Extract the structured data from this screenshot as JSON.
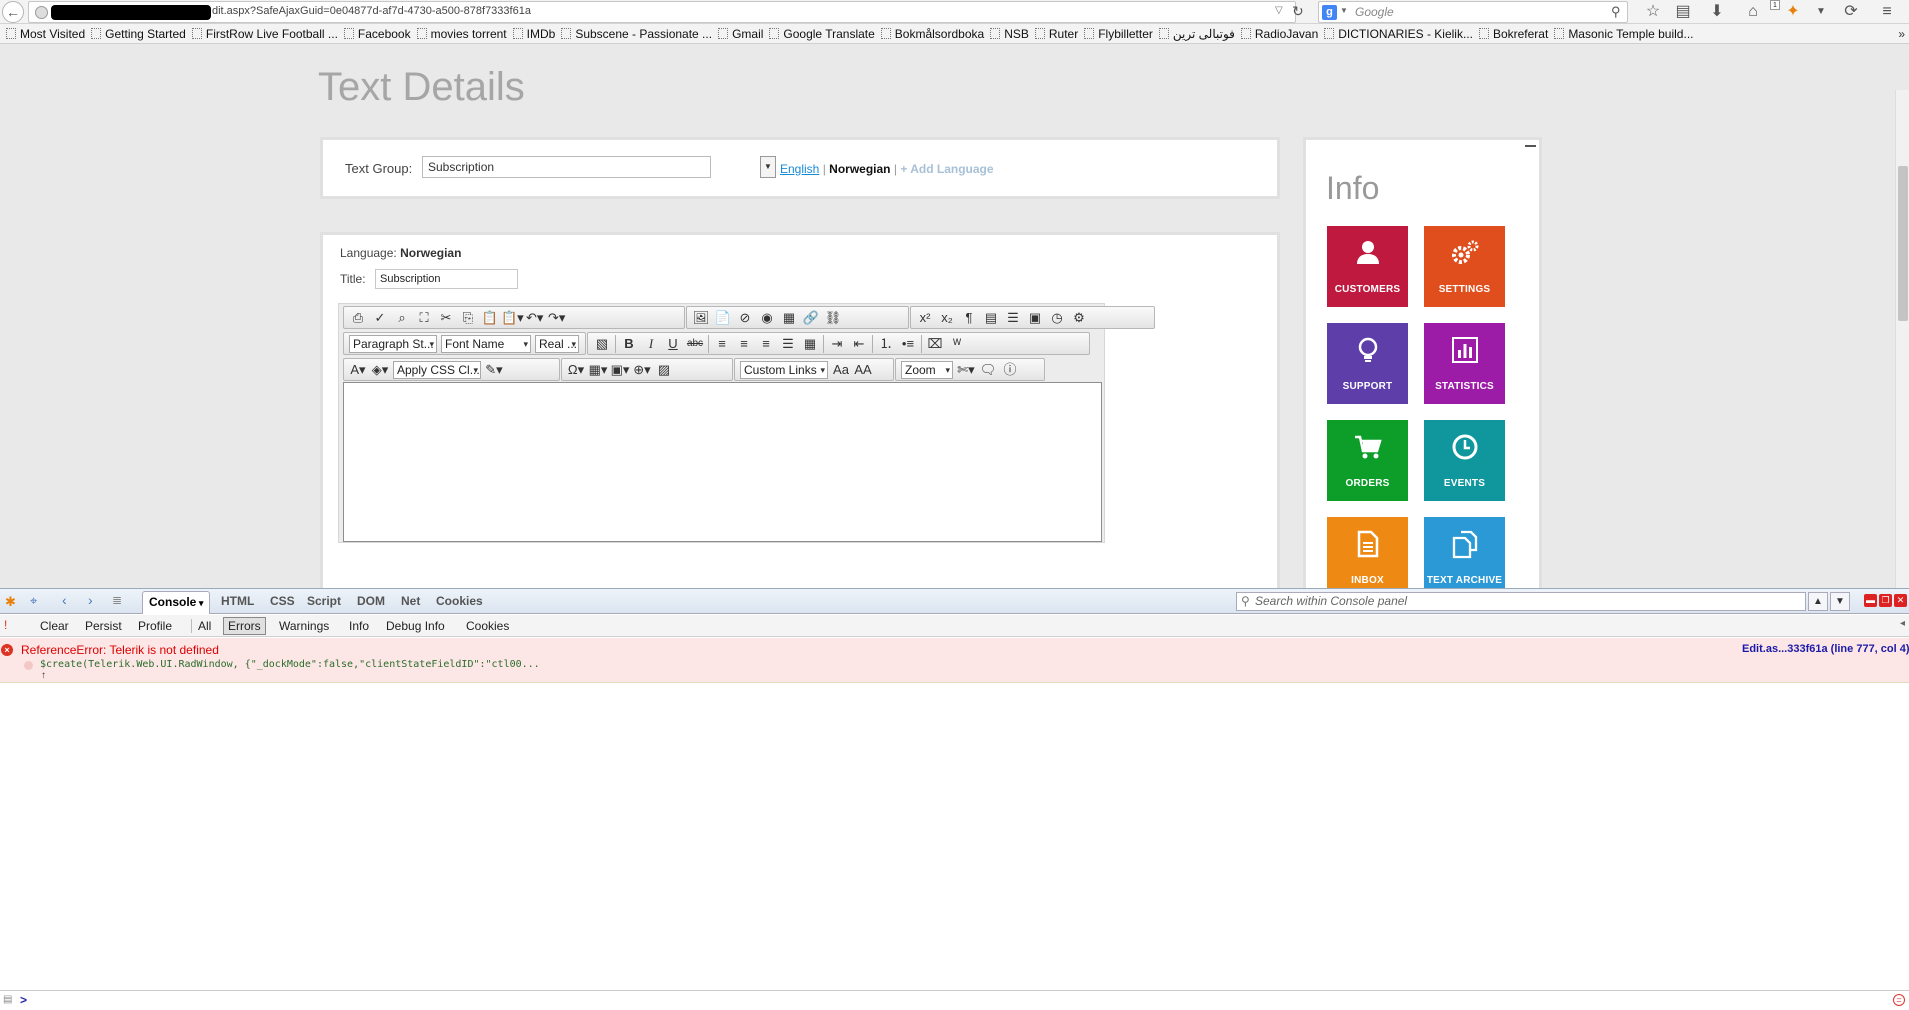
{
  "browser": {
    "url_text": "dit.aspx?SafeAjaxGuid=0e04877d-af7d-4730-a500-878f7333f61a",
    "search_placeholder": "Google",
    "search_engine_letter": "g",
    "notification_count": "1",
    "bookmarks": [
      "Most Visited",
      "Getting Started",
      "FirstRow Live Football ...",
      "Facebook",
      "movies torrent",
      "IMDb",
      "Subscene - Passionate ...",
      "Gmail",
      "Google Translate",
      "Bokmålsordboka",
      "NSB",
      "Ruter",
      "Flybilletter",
      "فوتبالی ترین",
      "RadioJavan",
      "DICTIONARIES - Kielik...",
      "Bokreferat",
      "Masonic Temple build..."
    ],
    "bookmarks_more": "»"
  },
  "page": {
    "title": "Text Details",
    "text_group": {
      "label": "Text Group:",
      "value": "Subscription",
      "lang_english": "English",
      "sep1": "|",
      "lang_norwegian": "Norwegian",
      "sep2": "|",
      "add_language": "+ Add Language"
    },
    "language_label": "Language:",
    "language_value": "Norwegian",
    "title_label": "Title:",
    "title_value": "Subscription",
    "editor": {
      "paragraph_style": "Paragraph St...",
      "font_name": "Font Name",
      "font_size": "Real ...",
      "apply_css": "Apply CSS Cl...",
      "custom_links": "Custom Links",
      "zoom": "Zoom"
    }
  },
  "info": {
    "title": "Info",
    "tiles": [
      {
        "label": "CUSTOMERS",
        "color": "#c0193f",
        "icon": "user-icon"
      },
      {
        "label": "SETTINGS",
        "color": "#e04e1e",
        "icon": "gears-icon"
      },
      {
        "label": "SUPPORT",
        "color": "#5e3ea9",
        "icon": "lightbulb-icon"
      },
      {
        "label": "STATISTICS",
        "color": "#9c1ca8",
        "icon": "bar-chart-icon"
      },
      {
        "label": "ORDERS",
        "color": "#0d9e2a",
        "icon": "cart-icon"
      },
      {
        "label": "EVENTS",
        "color": "#10979e",
        "icon": "clock-icon"
      },
      {
        "label": "INBOX",
        "color": "#ee8a13",
        "icon": "document-icon"
      },
      {
        "label": "TEXT ARCHIVE",
        "color": "#2a99d6",
        "icon": "copy-icon"
      }
    ]
  },
  "firebug": {
    "tabs": [
      "Console",
      "HTML",
      "CSS",
      "Script",
      "DOM",
      "Net",
      "Cookies"
    ],
    "search_placeholder": "Search within Console panel",
    "subbar": [
      "Clear",
      "Persist",
      "Profile",
      "All",
      "Errors",
      "Warnings",
      "Info",
      "Debug Info",
      "Cookies"
    ],
    "error": {
      "message": "ReferenceError: Telerik is not defined",
      "code": "$create(Telerik.Web.UI.RadWindow, {\"_dockMode\":false,\"clientStateFieldID\":\"ctl00...",
      "location": "Edit.as...333f61a (line 777, col 4)"
    },
    "prompt": ">"
  }
}
